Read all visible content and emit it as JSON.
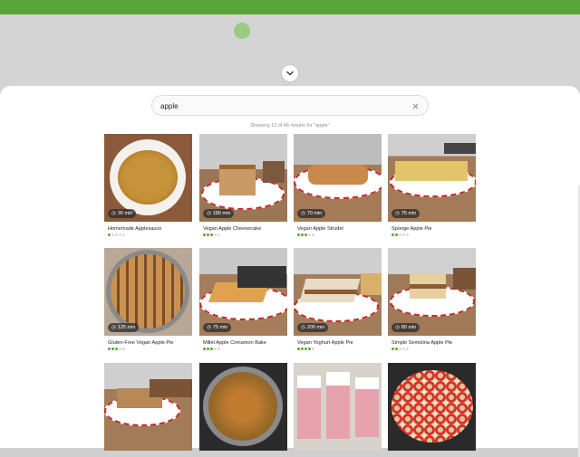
{
  "colors": {
    "accent": "#5aa53a",
    "panel": "#ffffff",
    "overlay": "#d4d4d4"
  },
  "background": {
    "topbar_left": "",
    "topbar_right": "",
    "logo_text": "",
    "nav": [],
    "breadcrumb": ""
  },
  "search": {
    "value": "apple",
    "placeholder": "",
    "clear_icon": "close-icon"
  },
  "results": {
    "count_text": "Showing 12 of 46 results for \"apple\""
  },
  "recipes": [
    {
      "title": "Homemade Applesauce",
      "time": "30 min",
      "rating": 1
    },
    {
      "title": "Vegan Apple Cheesecake",
      "time": "180 min",
      "rating": 3
    },
    {
      "title": "Vegan Apple Strudel",
      "time": "70 min",
      "rating": 3
    },
    {
      "title": "Sponge Apple Pie",
      "time": "75 min",
      "rating": 2
    },
    {
      "title": "Gluten-Free Vegan Apple Pie",
      "time": "125 min",
      "rating": 3
    },
    {
      "title": "Millet Apple Cinnamon Bake",
      "time": "75 min",
      "rating": 3
    },
    {
      "title": "Vegan Yoghurt Apple Pie",
      "time": "200 min",
      "rating": 4
    },
    {
      "title": "Simple Semolina Apple Pie",
      "time": "80 min",
      "rating": 2
    },
    {
      "title": "",
      "time": "",
      "rating": 0
    },
    {
      "title": "",
      "time": "",
      "rating": 0
    },
    {
      "title": "",
      "time": "",
      "rating": 0
    },
    {
      "title": "",
      "time": "",
      "rating": 0
    }
  ]
}
